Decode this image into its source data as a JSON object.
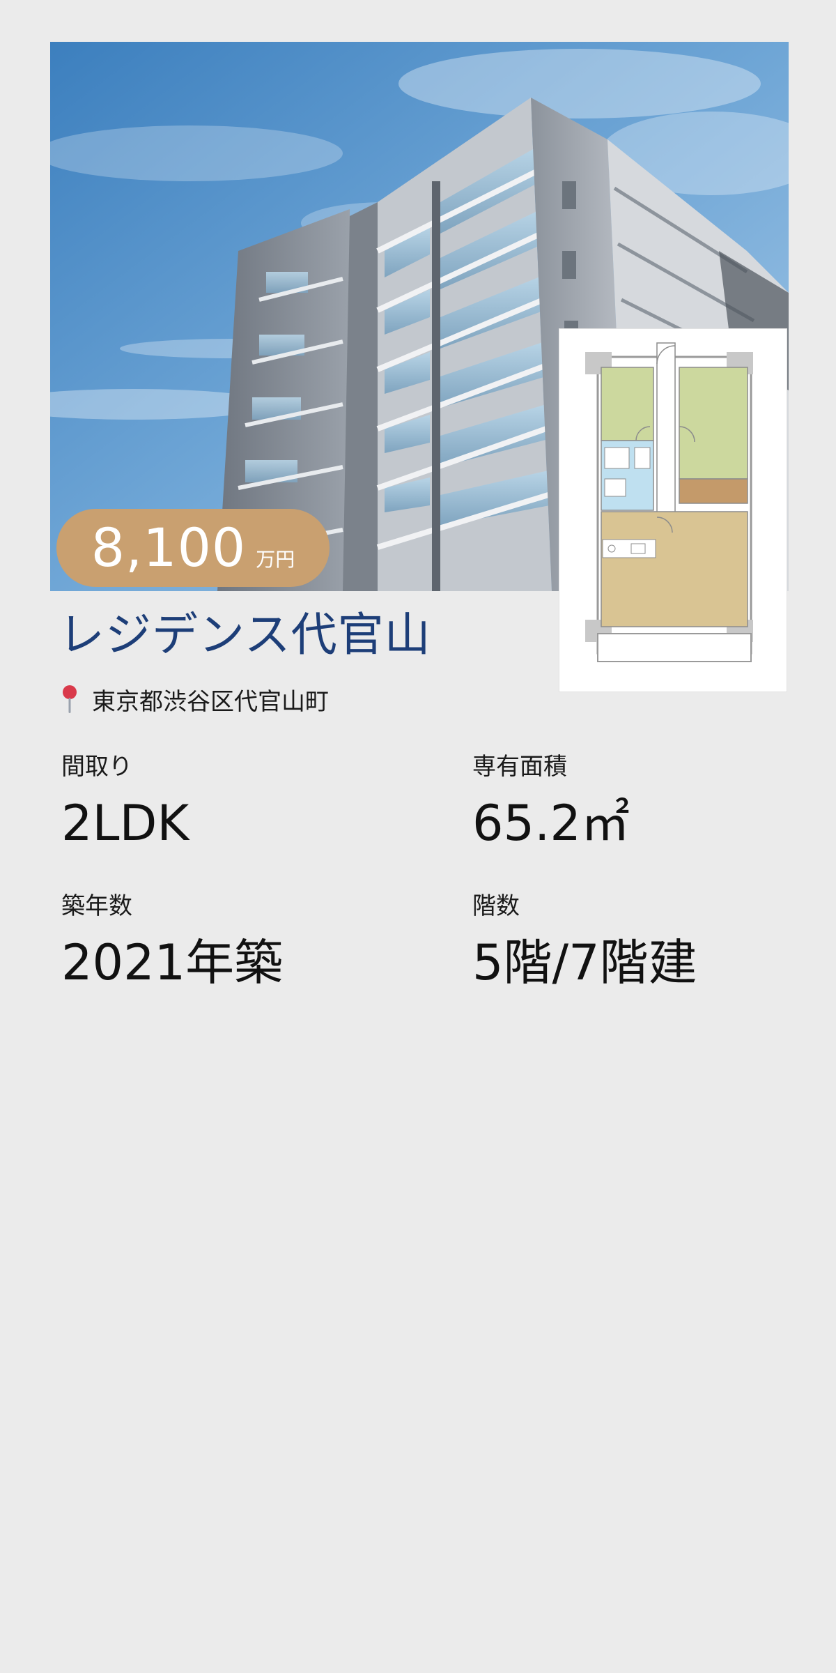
{
  "listing": {
    "price": {
      "value": "8,100",
      "unit": "万円"
    },
    "title": "レジデンス代官山",
    "address": "東京都渋谷区代官山町",
    "specs": [
      {
        "label": "間取り",
        "value": "2LDK"
      },
      {
        "label": "専有面積",
        "value": "65.2㎡"
      },
      {
        "label": "築年数",
        "value": "2021年築"
      },
      {
        "label": "階数",
        "value": "5階/7階建"
      }
    ]
  },
  "icons": {
    "location": "map-pin-icon"
  },
  "colors": {
    "background": "#ebebeb",
    "title": "#1d3e78",
    "price_badge": "#c9a070",
    "price_text": "#ffffff",
    "pin": "#d9394a"
  }
}
